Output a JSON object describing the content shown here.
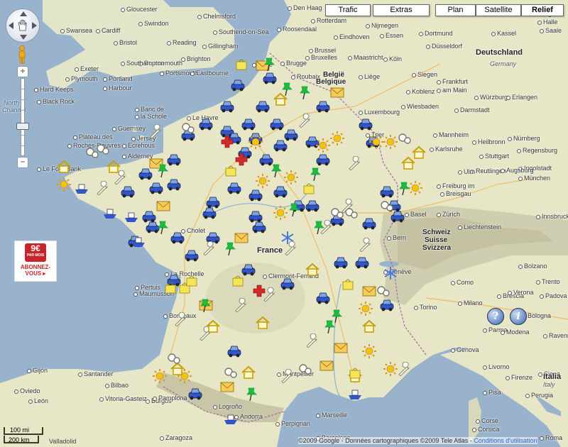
{
  "map_type_buttons": [
    {
      "label": "Trafic",
      "selected": false
    },
    {
      "label": "Extras",
      "selected": false
    },
    {
      "label": "Plan",
      "selected": false
    },
    {
      "label": "Satellite",
      "selected": false
    },
    {
      "label": "Relief",
      "selected": true
    }
  ],
  "zoom": {
    "plus": "+",
    "minus": "−"
  },
  "ad": {
    "price": "9€",
    "sub": "PAR MOIS",
    "cta": "ABONNEZ-VOUS ▸"
  },
  "scale": {
    "miles": "100 mi",
    "km": "200 km"
  },
  "copyright": {
    "text": "©2009 Google - Données cartographiques ©2009 Tele Atlas - ",
    "link": "Conditions d'utilisation"
  },
  "legal_fragment": "Valladolid",
  "places": [
    {
      "name": "Gloucester",
      "c": ""
    },
    {
      "name": "Swansea",
      "c": ""
    },
    {
      "name": "Cardiff",
      "c": ""
    },
    {
      "name": "Swindon",
      "c": ""
    },
    {
      "name": "Bristol",
      "c": ""
    },
    {
      "name": "Reading",
      "c": ""
    },
    {
      "name": "Southend-on-Sea",
      "c": ""
    },
    {
      "name": "Chelmsford",
      "c": ""
    },
    {
      "name": "Gillingham",
      "c": ""
    },
    {
      "name": "Exeter",
      "c": ""
    },
    {
      "name": "Bournemouth",
      "c": ""
    },
    {
      "name": "Southampton",
      "c": ""
    },
    {
      "name": "Brighton",
      "c": ""
    },
    {
      "name": "Plymouth",
      "c": ""
    },
    {
      "name": "Portland",
      "c": ""
    },
    {
      "name": "Harbour",
      "c": ""
    },
    {
      "name": "Portsmouth",
      "c": ""
    },
    {
      "name": "Eastbourne",
      "c": ""
    },
    {
      "name": "Den Haag",
      "c": ""
    },
    {
      "name": "Rotterdam",
      "c": ""
    },
    {
      "name": "Nijmegen",
      "c": ""
    },
    {
      "name": "Eindhoven",
      "c": ""
    },
    {
      "name": "Essen",
      "c": ""
    },
    {
      "name": "Dortmund",
      "c": ""
    },
    {
      "name": "Göttingen",
      "c": ""
    },
    {
      "name": "Halle",
      "c": ""
    },
    {
      "name": "Saale",
      "c": ""
    },
    {
      "name": "Roosendaal",
      "c": ""
    },
    {
      "name": "Düsseldorf",
      "c": ""
    },
    {
      "name": "Brugge",
      "c": ""
    },
    {
      "name": "Brussel",
      "c": ""
    },
    {
      "name": "Bruxelles",
      "c": ""
    },
    {
      "name": "Maastricht",
      "c": ""
    },
    {
      "name": "Köln",
      "c": ""
    },
    {
      "name": "Siegen",
      "c": ""
    },
    {
      "name": "Kassel",
      "c": ""
    },
    {
      "name": "Deutschland",
      "c": "big"
    },
    {
      "name": "Germany",
      "c": "it"
    },
    {
      "name": "Hove",
      "c": ""
    },
    {
      "name": "Roubaix",
      "c": ""
    },
    {
      "name": "België",
      "c": "med"
    },
    {
      "name": "Belgique",
      "c": "med"
    },
    {
      "name": "Liège",
      "c": ""
    },
    {
      "name": "Frankfurt",
      "c": ""
    },
    {
      "name": "am Main",
      "c": ""
    },
    {
      "name": "Koblenz",
      "c": ""
    },
    {
      "name": "Würzburg",
      "c": ""
    },
    {
      "name": "Erlangen",
      "c": ""
    },
    {
      "name": "Wiesbaden",
      "c": ""
    },
    {
      "name": "Mannheim",
      "c": ""
    },
    {
      "name": "Nürnberg",
      "c": ""
    },
    {
      "name": "Hard Keeps",
      "c": ""
    },
    {
      "name": "Black Rock",
      "c": ""
    },
    {
      "name": "North",
      "c": "sea"
    },
    {
      "name": "Channel",
      "c": "sea"
    },
    {
      "name": "Banc de",
      "c": ""
    },
    {
      "name": "la Schole",
      "c": ""
    },
    {
      "name": "Le Havre",
      "c": ""
    },
    {
      "name": "Guernsey",
      "c": ""
    },
    {
      "name": "Jersey",
      "c": ""
    },
    {
      "name": "Plateau des",
      "c": ""
    },
    {
      "name": "Roches-Douvres",
      "c": ""
    },
    {
      "name": "Ecrehous",
      "c": ""
    },
    {
      "name": "Alderney",
      "c": ""
    },
    {
      "name": "Le Four Bank",
      "c": ""
    },
    {
      "name": "Luxembourg",
      "c": ""
    },
    {
      "name": "Trier",
      "c": ""
    },
    {
      "name": "Darmstadt",
      "c": ""
    },
    {
      "name": "Heilbronn",
      "c": ""
    },
    {
      "name": "Regensburg",
      "c": ""
    },
    {
      "name": "Karlsruhe",
      "c": ""
    },
    {
      "name": "Ingolstadt",
      "c": ""
    },
    {
      "name": "Stuttgart",
      "c": ""
    },
    {
      "name": "Reutlingen",
      "c": ""
    },
    {
      "name": "Augsburg",
      "c": ""
    },
    {
      "name": "München",
      "c": ""
    },
    {
      "name": "Ulm",
      "c": ""
    },
    {
      "name": "Freiburg im",
      "c": ""
    },
    {
      "name": "Breisgau",
      "c": ""
    },
    {
      "name": "Zürich",
      "c": ""
    },
    {
      "name": "Basel",
      "c": ""
    },
    {
      "name": "Bern",
      "c": ""
    },
    {
      "name": "Innsbruck",
      "c": ""
    },
    {
      "name": "Liechtenstein",
      "c": ""
    },
    {
      "name": "Schweiz",
      "c": "med"
    },
    {
      "name": "Suisse",
      "c": "med"
    },
    {
      "name": "Svizzera",
      "c": "med"
    },
    {
      "name": "France",
      "c": "big"
    },
    {
      "name": "Cholet",
      "c": ""
    },
    {
      "name": "Pertuis",
      "c": ""
    },
    {
      "name": "Maumusson",
      "c": ""
    },
    {
      "name": "La Rochelle",
      "c": ""
    },
    {
      "name": "Clermont-Ferrand",
      "c": ""
    },
    {
      "name": "Genève",
      "c": ""
    },
    {
      "name": "Bolzano",
      "c": ""
    },
    {
      "name": "Trento",
      "c": ""
    },
    {
      "name": "Como",
      "c": ""
    },
    {
      "name": "Milano",
      "c": ""
    },
    {
      "name": "Brescia",
      "c": ""
    },
    {
      "name": "Verona",
      "c": ""
    },
    {
      "name": "Padova",
      "c": ""
    },
    {
      "name": "Torino",
      "c": ""
    },
    {
      "name": "Parma",
      "c": ""
    },
    {
      "name": "Modena",
      "c": ""
    },
    {
      "name": "Bologna",
      "c": ""
    },
    {
      "name": "Genova",
      "c": ""
    },
    {
      "name": "Ravenna",
      "c": ""
    },
    {
      "name": "Bordeaux",
      "c": ""
    },
    {
      "name": "Montpellier",
      "c": ""
    },
    {
      "name": "Marseille",
      "c": ""
    },
    {
      "name": "Livorno",
      "c": ""
    },
    {
      "name": "Firenze",
      "c": ""
    },
    {
      "name": "Pisa",
      "c": ""
    },
    {
      "name": "Siena",
      "c": ""
    },
    {
      "name": "Italia",
      "c": "big"
    },
    {
      "name": "Italy",
      "c": "it"
    },
    {
      "name": "Perugia",
      "c": ""
    },
    {
      "name": "Gijón",
      "c": ""
    },
    {
      "name": "Santander",
      "c": ""
    },
    {
      "name": "Bilbao",
      "c": ""
    },
    {
      "name": "Oviedo",
      "c": ""
    },
    {
      "name": "Vitoria-Gasteiz",
      "c": ""
    },
    {
      "name": "Burgos",
      "c": ""
    },
    {
      "name": "León",
      "c": ""
    },
    {
      "name": "Pamplona",
      "c": ""
    },
    {
      "name": "Andorra",
      "c": ""
    },
    {
      "name": "Perpignan",
      "c": ""
    },
    {
      "name": "Corse",
      "c": ""
    },
    {
      "name": "Corsica",
      "c": ""
    },
    {
      "name": "Roma",
      "c": ""
    },
    {
      "name": "Zaragoza",
      "c": ""
    },
    {
      "name": "Barcelona",
      "c": ""
    },
    {
      "name": "Logroño",
      "c": ""
    }
  ],
  "marker_types": {
    "car": "car-icon",
    "sun": "sun-icon",
    "wrench": "wrench-icon",
    "house": "house-icon",
    "mail": "envelope-icon",
    "pin": "pushpin-icon",
    "cross": "hospital-icon",
    "snow": "snowflake-icon",
    "boat": "boat-icon",
    "gear": "gear-icon",
    "bag": "shopping-bag-icon"
  },
  "colors": {
    "land": "#e7e7c8",
    "water": "#99b3cc",
    "mountain": "#c9c8a9",
    "car": "#3355cc",
    "sun": "#f5c400",
    "pin": "#22bb33",
    "cross": "#d02a2a"
  }
}
